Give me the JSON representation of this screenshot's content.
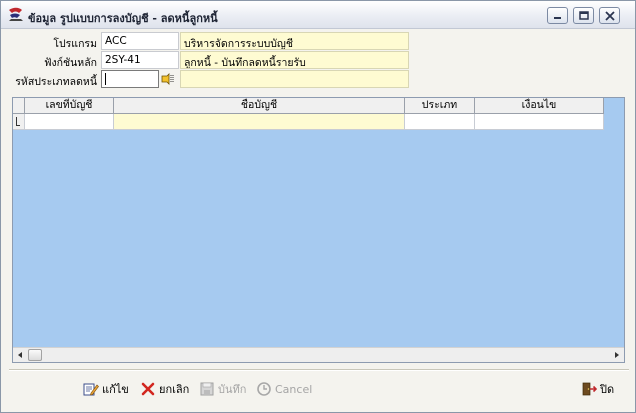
{
  "window": {
    "title": "ข้อมูล รูปแบบการลงบัญชี - ลดหนี้ลูกหนี้",
    "controls": [
      "minimize",
      "maximize",
      "close"
    ]
  },
  "form": {
    "program_label": "โปรแกรม",
    "program_code": "ACC",
    "program_name": "บริหารจัดการระบบบัญชี",
    "function_label": "ฟังก์ชันหลัก",
    "function_code": "2SY-41",
    "function_name": "ลูกหนี้ - บันทึกลดหนี้รายรับ",
    "reduction_type_label": "รหัสประเภทลดหนี้",
    "reduction_type_value": "",
    "reduction_type_name": ""
  },
  "grid": {
    "columns": [
      "เลขที่บัญชี",
      "ชื่อบัญชี",
      "ประเภท",
      "เงื่อนไข"
    ],
    "rows": [
      {
        "account_no": "",
        "account_name": "",
        "type": "",
        "condition": ""
      }
    ]
  },
  "toolbar": {
    "edit_label": "แก้ไข",
    "cancel_th_label": "ยกเลิก",
    "save_label": "บันทึก",
    "cancel_label": "Cancel",
    "close_label": "ปิด"
  },
  "colors": {
    "grid_background": "#a6caf0",
    "readonly_field": "#fefbd2",
    "window_bg": "#f4f3ee"
  }
}
